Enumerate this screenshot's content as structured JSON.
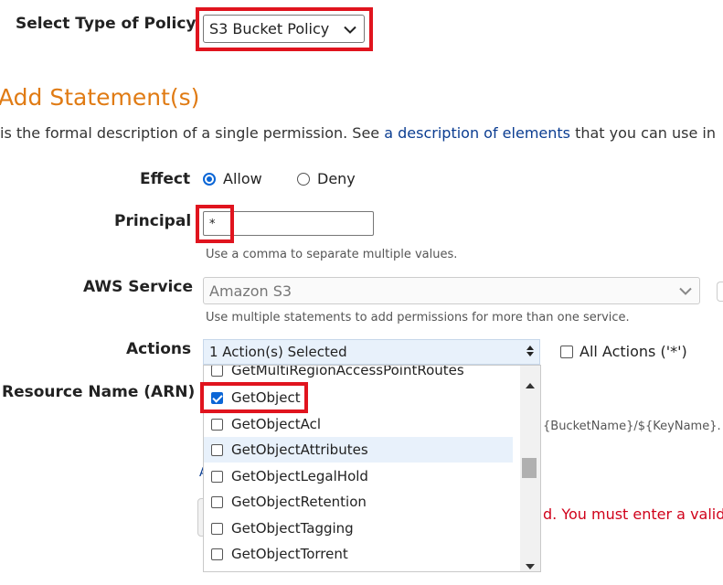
{
  "policy_type": {
    "label": "Select Type of Policy",
    "value": "S3 Bucket Policy"
  },
  "section_title": "Add Statement(s)",
  "intro": {
    "text_before": "is the formal description of a single permission. See ",
    "link": "a description of elements",
    "text_after": " that you can use in"
  },
  "effect": {
    "label": "Effect",
    "options": [
      "Allow",
      "Deny"
    ],
    "selected": "Allow"
  },
  "principal": {
    "label": "Principal",
    "value": "*",
    "help": "Use a comma to separate multiple values."
  },
  "aws_service": {
    "label": "AWS Service",
    "value": "Amazon S3",
    "help": "Use multiple statements to add permissions for more than one service."
  },
  "actions": {
    "label": "Actions",
    "value": "1 Action(s) Selected",
    "all_actions_label": "All Actions ('*')",
    "items": [
      {
        "label": "GetMultiRegionAccessPointRoutes",
        "checked": false
      },
      {
        "label": "GetObject",
        "checked": true
      },
      {
        "label": "GetObjectAcl",
        "checked": false
      },
      {
        "label": "GetObjectAttributes",
        "checked": false
      },
      {
        "label": "GetObjectLegalHold",
        "checked": false
      },
      {
        "label": "GetObjectRetention",
        "checked": false
      },
      {
        "label": "GetObjectTagging",
        "checked": false
      },
      {
        "label": "GetObjectTorrent",
        "checked": false
      }
    ]
  },
  "arn": {
    "label": "Resource Name (ARN)",
    "help_fragment": "{BucketName}/${KeyName}."
  },
  "error_fragment": "d. You must enter a valid",
  "colors": {
    "accent": "#0b66d6",
    "title": "#e07b14",
    "error": "#d0021b",
    "highlight": "#e0141e",
    "link": "#0b3d91"
  }
}
